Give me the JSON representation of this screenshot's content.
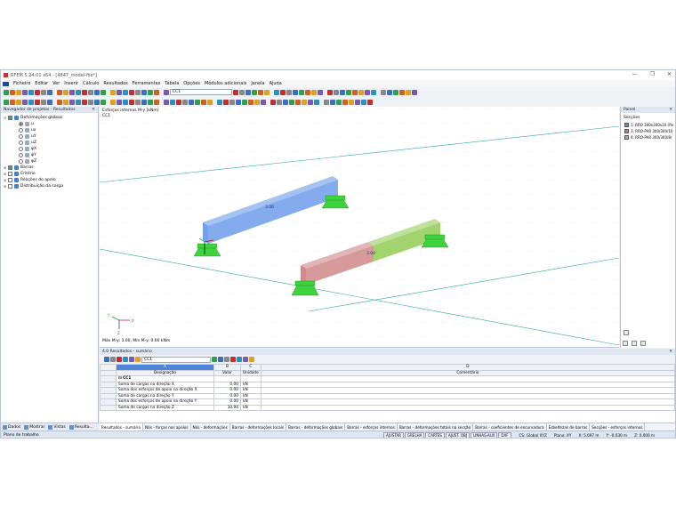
{
  "window": {
    "title": "RFEM 5.24.01 x64 - [4847_model-file*]",
    "min": "—",
    "max": "❐",
    "close": "✕"
  },
  "menu": [
    "Ficheiro",
    "Editar",
    "Ver",
    "Inserir",
    "Cálculo",
    "Resultados",
    "Ferramentas",
    "Tabela",
    "Opções",
    "Módulos adicionais",
    "Janela",
    "Ajuda"
  ],
  "toolbar": {
    "loadcase": "CC1"
  },
  "navigator": {
    "title": "Navegador de projetos - Resultados",
    "items": [
      {
        "label": "Deformações globais",
        "level": 0,
        "kind": "check",
        "on": true,
        "exp": "⊟"
      },
      {
        "label": "u",
        "level": 1,
        "kind": "radio",
        "on": true
      },
      {
        "label": "ux",
        "level": 1,
        "kind": "radio",
        "on": false
      },
      {
        "label": "uY",
        "level": 1,
        "kind": "radio",
        "on": false
      },
      {
        "label": "uZ",
        "level": 1,
        "kind": "radio",
        "on": false
      },
      {
        "label": "φX",
        "level": 1,
        "kind": "radio",
        "on": false
      },
      {
        "label": "φY",
        "level": 1,
        "kind": "radio",
        "on": false
      },
      {
        "label": "φZ",
        "level": 1,
        "kind": "radio",
        "on": false
      },
      {
        "label": "Barras",
        "level": 0,
        "kind": "check",
        "on": true,
        "exp": "⊞"
      },
      {
        "label": "Critério",
        "level": 0,
        "kind": "check",
        "on": false,
        "exp": "⊞"
      },
      {
        "label": "Reações do apoio",
        "level": 0,
        "kind": "check",
        "on": false,
        "exp": "⊞"
      },
      {
        "label": "Distribuição da carga",
        "level": 0,
        "kind": "check",
        "on": false,
        "exp": "⊞"
      }
    ],
    "tabs": [
      "Dados",
      "Mostrar",
      "Vistas",
      "Resulta..."
    ]
  },
  "viewport": {
    "line1": "Esforços internos M-y [kNm]",
    "line2": "CC1",
    "footer": "Máx M-y: 3.00, Mín M-y: 0.00 kNm",
    "label_blue": "3.00",
    "label_red": "3.00",
    "axis_z": "Z",
    "axis_x": "X",
    "axis_y": "Y"
  },
  "panel": {
    "title": "Painel",
    "subtitle": "Secções",
    "items": [
      {
        "label": "1: RRO 300x300x10 (fle",
        "color": "#5a8fe8"
      },
      {
        "label": "3: RRO-PAR 300/300/10",
        "color": "#c87878"
      },
      {
        "label": "4: RRO-PAR 300/300/8/",
        "color": "#8cc84a"
      }
    ]
  },
  "results": {
    "title": "4.0 Resultados - sumário",
    "loadcase": "CC1",
    "columns": [
      {
        "letter": "A",
        "name": "Designação"
      },
      {
        "letter": "B",
        "name": "Valor"
      },
      {
        "letter": "C",
        "name": "Unidade"
      },
      {
        "letter": "D",
        "name": "Comentário"
      }
    ],
    "group": "CC1",
    "rows": [
      {
        "name": "Soma de cargas na direção X",
        "value": "0.00",
        "unit": "kN"
      },
      {
        "name": "Soma dos esforços de apoio na direção X",
        "value": "0.00",
        "unit": "kN"
      },
      {
        "name": "Soma de cargas na direção Y",
        "value": "0.00",
        "unit": "kN"
      },
      {
        "name": "Soma dos esforços de apoio na direção Y",
        "value": "0.00",
        "unit": "kN"
      },
      {
        "name": "Soma de cargas na direção Z",
        "value": "10.94",
        "unit": "kN"
      }
    ],
    "tabs": [
      "Resultados - sumário",
      "Nós - forças nos apoios",
      "Nós - deformações",
      "Barras - deformações locais",
      "Barras - deformações globais",
      "Barras - esforços internos",
      "Barras - deformações totais na secção",
      "Barras - coeficientes de encurvadura",
      "Esbeltezas de barras",
      "Secções - esforços internos"
    ]
  },
  "status": {
    "text": "Plano de trabalho",
    "buttons": [
      "AJUSTAR",
      "GRELHA",
      "CARTES",
      "AJUST. OBJ",
      "LINHAS-AUX",
      "DXF"
    ],
    "cs": "CS: Global XYZ",
    "plane": "Plano: XY",
    "x": "X: 5.097 m",
    "y": "Y: -0.030 m",
    "z": "Z: 0.000 m"
  },
  "colors": {
    "blue": "#5a8fe8",
    "red": "#c87878",
    "green": "#8cc84a",
    "support": "#3ed23e",
    "grid": "#2fa9a0"
  }
}
